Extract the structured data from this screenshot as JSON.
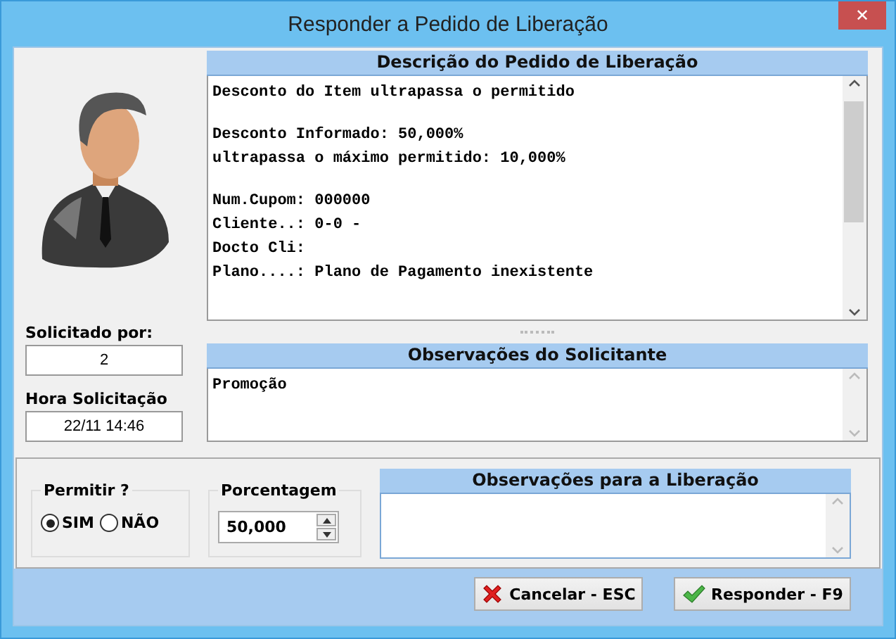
{
  "window": {
    "title": "Responder a Pedido de Liberação",
    "close": "✕"
  },
  "description": {
    "title": "Descrição do Pedido de Liberação",
    "paragraphs": [
      [
        "Desconto do Item ultrapassa o permitido"
      ],
      [
        "Desconto Informado: 50,000%",
        "ultrapassa o máximo permitido: 10,000%"
      ],
      [
        "Num.Cupom: 000000",
        "Cliente..: 0-0 -",
        "Docto Cli:",
        "Plano....: Plano de Pagamento inexistente"
      ]
    ]
  },
  "requested_by": {
    "label": "Solicitado por:",
    "value": "2"
  },
  "request_time": {
    "label": "Hora Solicitação",
    "value": "22/11 14:46"
  },
  "requester_notes": {
    "title": "Observações do Solicitante",
    "value": "Promoção"
  },
  "permit": {
    "label": "Permitir ?",
    "options": [
      {
        "label": "SIM",
        "selected": true
      },
      {
        "label": "NÃO",
        "selected": false
      }
    ]
  },
  "percentage": {
    "label": "Porcentagem",
    "value": "50,000"
  },
  "release_notes": {
    "title": "Observações para a Liberação"
  },
  "buttons": [
    {
      "kind": "cancel",
      "label": "Cancelar - ESC"
    },
    {
      "kind": "confirm",
      "label": "Responder - F9"
    }
  ]
}
